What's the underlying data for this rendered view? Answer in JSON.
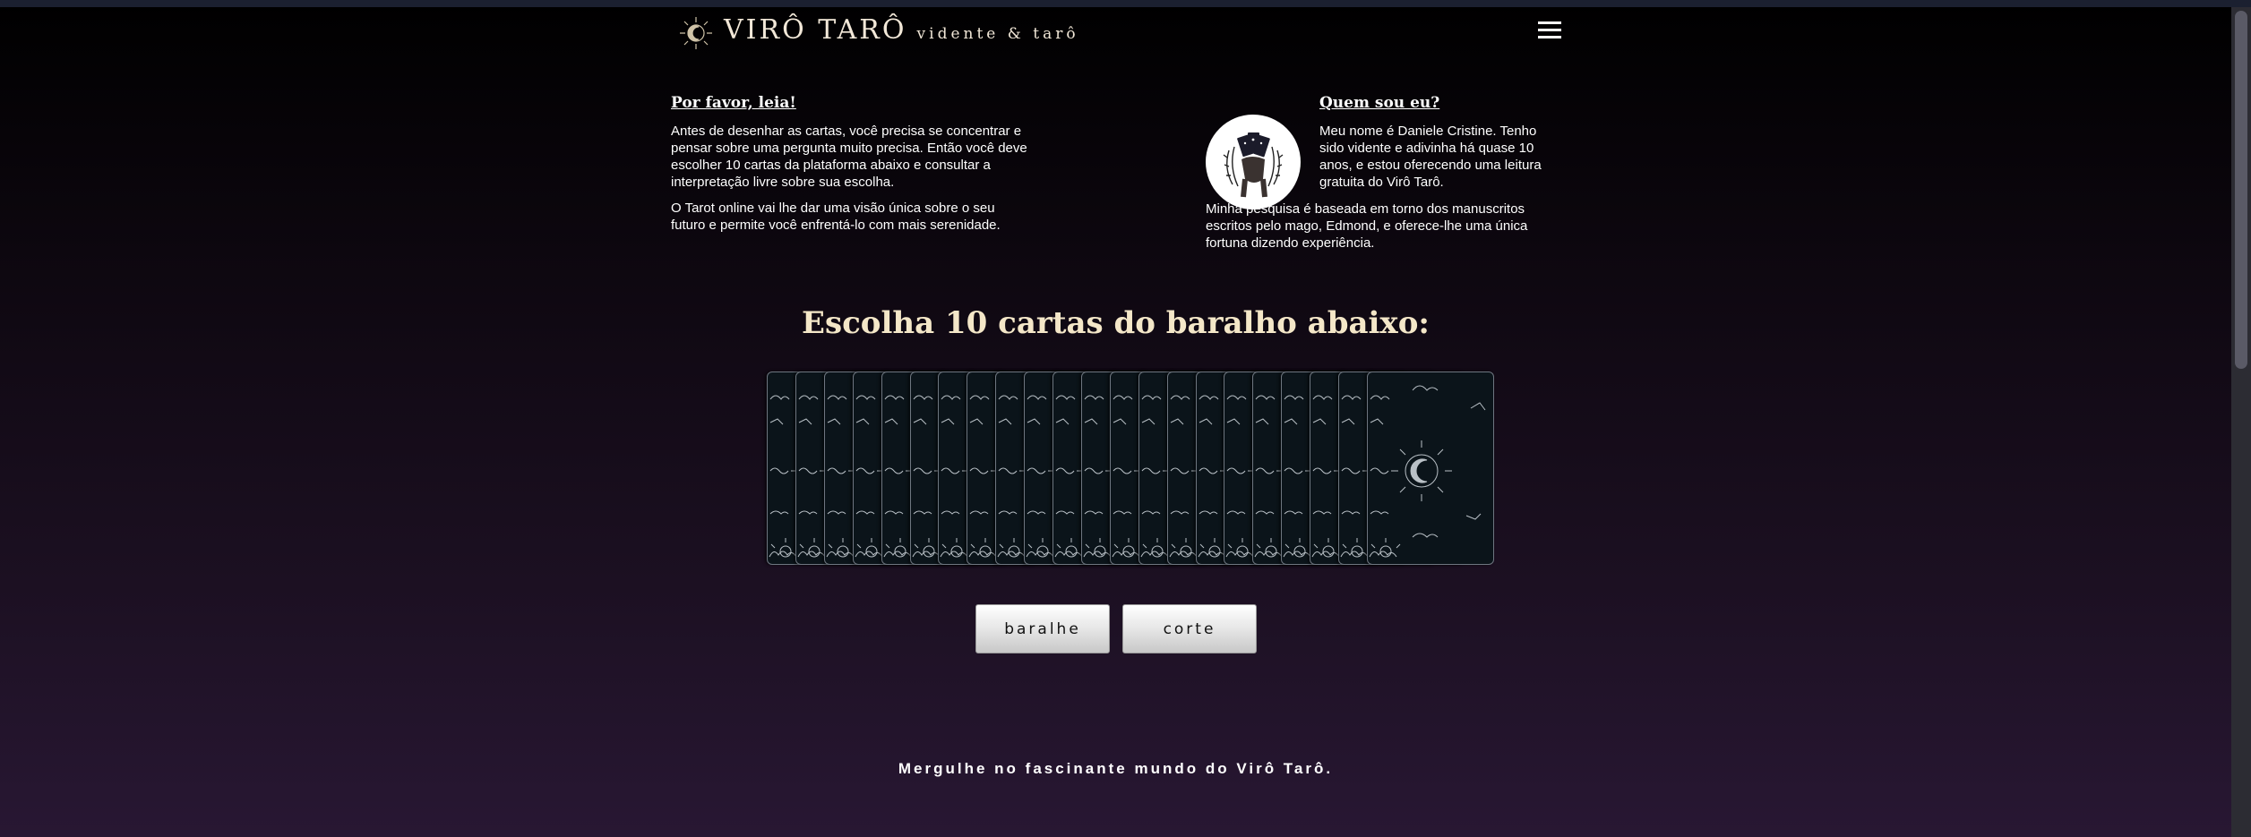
{
  "header": {
    "brand_name": "VIRÔ TARÔ",
    "brand_tagline": "vidente & tarô",
    "logo_icon": "sun-moon-icon",
    "menu_icon": "hamburger-menu-icon"
  },
  "intro": {
    "title": "Por favor, leia!",
    "paragraphs": [
      "Antes de desenhar as cartas, você precisa se concentrar e pensar sobre uma pergunta muito precisa. Então você deve escolher 10 cartas da plataforma abaixo e consultar a interpretação livre sobre sua escolha.",
      "O Tarot online vai lhe dar uma visão única sobre o seu futuro e permite você enfrentá-lo com mais serenidade."
    ]
  },
  "about": {
    "title": "Quem sou eu?",
    "paragraph1": "Meu nome é Daniele Cristine. Tenho sido vidente e adivinha há quase 10 anos, e estou oferecendo uma leitura gratuita do Virô Tarô.",
    "paragraph2": "Minha pesquisa é baseada em torno dos manuscritos escritos pelo mago, Edmond, e oferece-lhe uma única fortuna dizendo experiência.",
    "avatar_icon": "hand-holding-cards-icon"
  },
  "deck": {
    "title": "Escolha 10 cartas do baralho abaixo:",
    "card_count": 22,
    "card_back_icon": "sun-moon-card-back-icon"
  },
  "actions": {
    "shuffle_label": "baralhe",
    "cut_label": "corte"
  },
  "footer": {
    "text": "Mergulhe no fascinante mundo do Virô Tarô."
  },
  "colors": {
    "background_top": "#000000",
    "background_bottom": "#281733",
    "title_cream": "#f4e7c8",
    "card_back": "#0b141a"
  }
}
